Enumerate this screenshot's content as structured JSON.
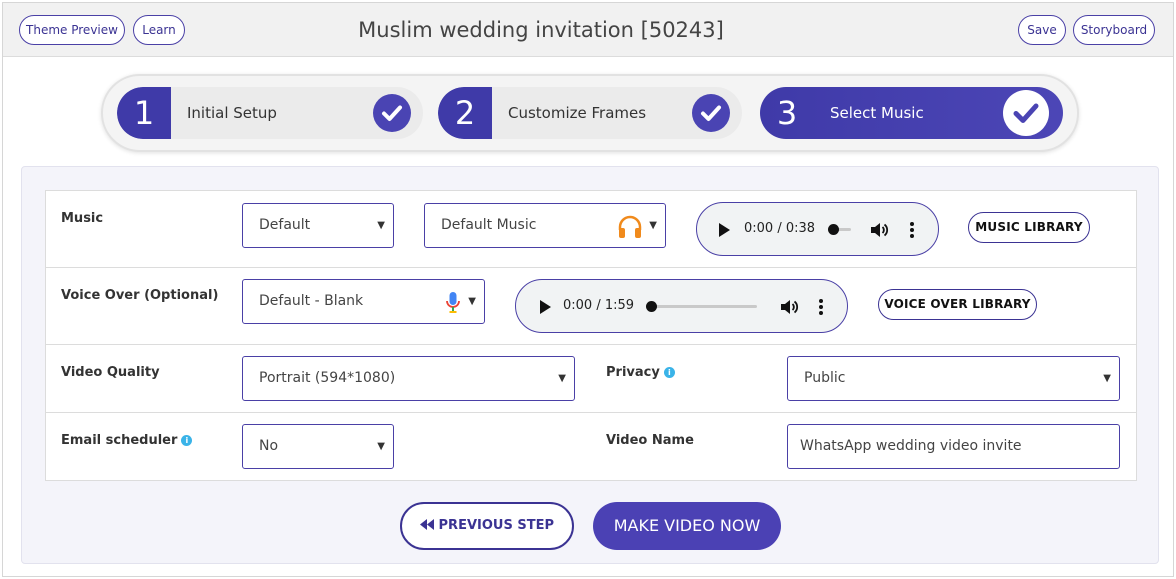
{
  "header": {
    "theme_preview_label": "Theme Preview",
    "learn_label": "Learn",
    "title": "Muslim wedding invitation [50243]",
    "save_label": "Save",
    "storyboard_label": "Storyboard"
  },
  "steps": [
    {
      "number": "1",
      "label": "Initial Setup",
      "completed": true
    },
    {
      "number": "2",
      "label": "Customize Frames",
      "completed": true
    },
    {
      "number": "3",
      "label": "Select Music",
      "completed": true,
      "active": true
    }
  ],
  "form": {
    "music": {
      "label": "Music",
      "source_value": "Default",
      "track_value": "Default Music",
      "audio_time": "0:00 / 0:38",
      "library_label": "MUSIC LIBRARY"
    },
    "voice_over": {
      "label": "Voice Over (Optional)",
      "value": "Default - Blank",
      "audio_time": "0:00 / 1:59",
      "library_label": "VOICE OVER LIBRARY"
    },
    "video_quality": {
      "label": "Video Quality",
      "value": "Portrait (594*1080)"
    },
    "privacy": {
      "label": "Privacy",
      "value": "Public"
    },
    "email_scheduler": {
      "label": "Email scheduler",
      "value": "No"
    },
    "video_name": {
      "label": "Video Name",
      "value": "WhatsApp wedding video invite"
    }
  },
  "actions": {
    "previous_label": "PREVIOUS STEP",
    "make_label": "MAKE VIDEO NOW"
  },
  "colors": {
    "accent": "#3f3aa8",
    "button_primary": "#4b41b4",
    "info_icon": "#3ab3e8",
    "headphone_icon": "#f08a1c"
  }
}
